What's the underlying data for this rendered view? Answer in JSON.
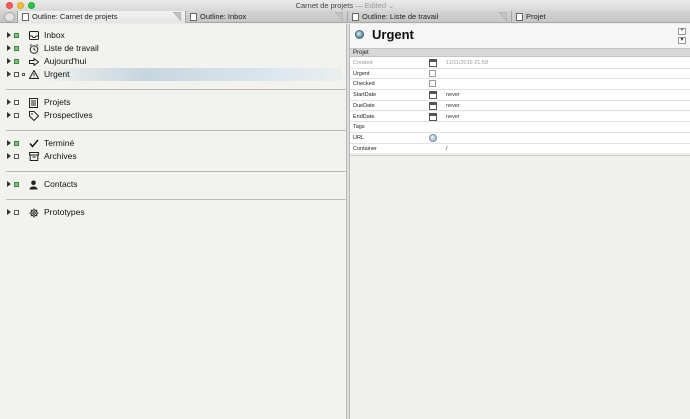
{
  "window": {
    "title": "Carnet de projets",
    "edited_suffix": "— Edited ⌄"
  },
  "tabs": [
    {
      "label": "Outline: Carnet de projets",
      "active": true
    },
    {
      "label": "Outline: Inbox",
      "active": false
    },
    {
      "label": "Outline: Liste de travail",
      "active": false
    },
    {
      "label": "Projet",
      "active": false
    }
  ],
  "outline": {
    "items": [
      {
        "label": "Inbox",
        "icon": "inbox-icon",
        "dot": "green"
      },
      {
        "label": "Liste de travail",
        "icon": "clock-icon",
        "dot": "green"
      },
      {
        "label": "Aujourd'hui",
        "icon": "arrow-right-icon",
        "dot": "green"
      },
      {
        "label": "Urgent",
        "icon": "warning-icon",
        "dot": "white",
        "selected": true
      },
      {
        "label": "Projets",
        "icon": "list-icon",
        "dot": "white"
      },
      {
        "label": "Prospectives",
        "icon": "tag-icon",
        "dot": "white"
      },
      {
        "label": "Terminé",
        "icon": "checkmark-icon",
        "dot": "green"
      },
      {
        "label": "Archives",
        "icon": "archive-box-icon",
        "dot": "white"
      },
      {
        "label": "Contacts",
        "icon": "person-icon",
        "dot": "green"
      },
      {
        "label": "Prototypes",
        "icon": "gear-icon",
        "dot": "white"
      }
    ]
  },
  "inspector": {
    "title": "Urgent",
    "add_button": "+",
    "nav_button": "▾",
    "group_label": "Projet",
    "properties": [
      {
        "key": "Created",
        "value": "11/11/2016 21:58",
        "control": "calendar",
        "muted": true
      },
      {
        "key": "Urgent",
        "value": "",
        "control": "checkbox"
      },
      {
        "key": "Checked",
        "value": "",
        "control": "checkbox"
      },
      {
        "key": "StartDate",
        "value": "never",
        "control": "calendar"
      },
      {
        "key": "DueDate",
        "value": "never",
        "control": "calendar"
      },
      {
        "key": "EndDate",
        "value": "never",
        "control": "calendar"
      },
      {
        "key": "Tags",
        "value": "",
        "control": "none"
      },
      {
        "key": "URL",
        "value": "",
        "control": "globe"
      },
      {
        "key": "Container",
        "value": "/",
        "control": "none"
      }
    ]
  },
  "colors": {
    "accent_selection": "#c6d6df",
    "status_green": "#7bc57b"
  }
}
